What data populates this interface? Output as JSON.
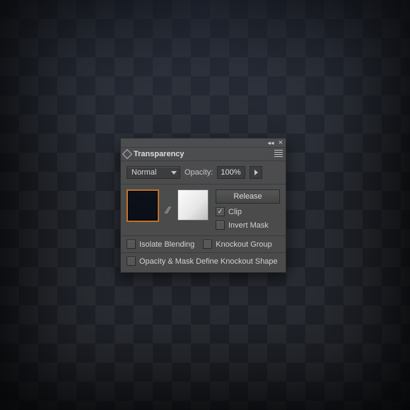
{
  "panel": {
    "title": "Transparency",
    "blendMode": "Normal",
    "opacityLabel": "Opacity:",
    "opacityValue": "100%",
    "releaseBtn": "Release",
    "clipLabel": "Clip",
    "invertLabel": "Invert Mask",
    "isolateLabel": "Isolate Blending",
    "knockoutLabel": "Knockout Group",
    "defineLabel": "Opacity & Mask Define Knockout Shape"
  }
}
